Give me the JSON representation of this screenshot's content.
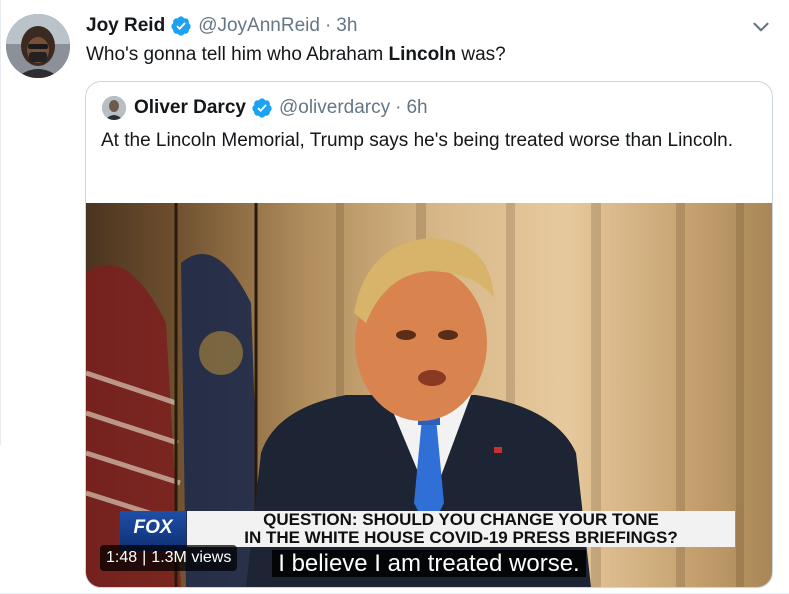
{
  "tweet": {
    "author_name": "Joy Reid",
    "handle": "@JoyAnnReid",
    "separator": "·",
    "time": "3h",
    "text_before": "Who's gonna tell him who Abraham ",
    "text_bold": "Lincoln",
    "text_after": " was?"
  },
  "quoted_tweet": {
    "author_name": "Oliver Darcy",
    "handle": "@oliverdarcy",
    "separator": "·",
    "time": "6h",
    "text": "At the Lincoln Memorial, Trump says he's being treated worse than Lincoln."
  },
  "video": {
    "chyron_line1": "QUESTION: SHOULD YOU CHANGE YOUR TONE",
    "chyron_line2": "IN THE WHITE HOUSE COVID-19 PRESS BRIEFINGS?",
    "network_logo": "FOX",
    "subtitle": "I believe I am treated worse.",
    "duration": "1:48",
    "views": "1.3M views",
    "meta_separator": "|"
  },
  "colors": {
    "verified_blue": "#1da1f2",
    "secondary_text": "#657786",
    "border": "#ccd6dd"
  },
  "icons": [
    "verified-badge-icon",
    "chevron-down-icon"
  ]
}
